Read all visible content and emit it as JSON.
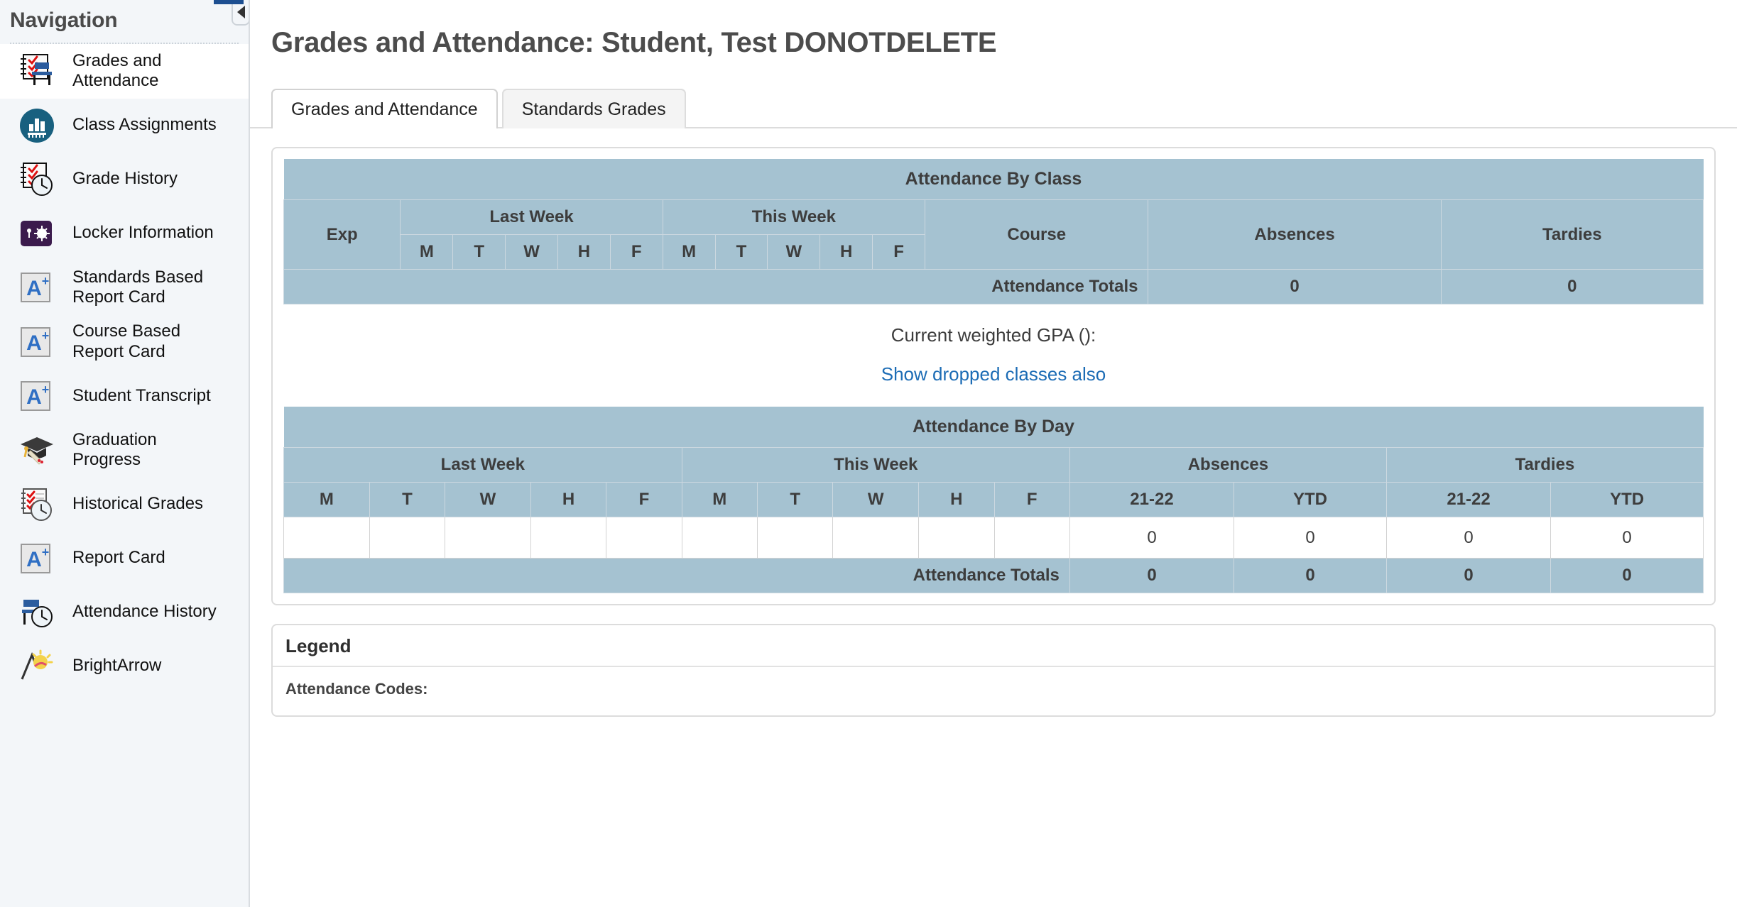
{
  "sidebar": {
    "title": "Navigation",
    "collapse_icon": "chevron-left-icon",
    "items": [
      {
        "label": "Grades and Attendance",
        "icon": "grades-attendance-icon",
        "active": true
      },
      {
        "label": "Class Assignments",
        "icon": "class-assignments-icon",
        "active": false
      },
      {
        "label": "Grade History",
        "icon": "grade-history-icon",
        "active": false
      },
      {
        "label": "Locker Information",
        "icon": "locker-information-icon",
        "active": false
      },
      {
        "label": "Standards Based Report Card",
        "icon": "report-card-a-plus-icon",
        "active": false
      },
      {
        "label": "Course Based Report Card",
        "icon": "report-card-a-plus-icon",
        "active": false
      },
      {
        "label": "Student Transcript",
        "icon": "report-card-a-plus-icon",
        "active": false
      },
      {
        "label": "Graduation Progress",
        "icon": "graduation-cap-icon",
        "active": false
      },
      {
        "label": "Historical Grades",
        "icon": "historical-grades-icon",
        "active": false
      },
      {
        "label": "Report Card",
        "icon": "report-card-a-plus-icon",
        "active": false
      },
      {
        "label": "Attendance History",
        "icon": "attendance-history-icon",
        "active": false
      },
      {
        "label": "BrightArrow",
        "icon": "brightarrow-icon",
        "active": false
      }
    ]
  },
  "header": {
    "page_title": "Grades and Attendance: Student, Test DONOTDELETE"
  },
  "tabs": [
    {
      "label": "Grades and Attendance",
      "active": true
    },
    {
      "label": "Standards Grades",
      "active": false
    }
  ],
  "attendance_by_class": {
    "title": "Attendance By Class",
    "exp_header": "Exp",
    "last_week_header": "Last Week",
    "this_week_header": "This Week",
    "days": [
      "M",
      "T",
      "W",
      "H",
      "F"
    ],
    "course_header": "Course",
    "absences_header": "Absences",
    "tardies_header": "Tardies",
    "totals_label": "Attendance Totals",
    "totals_absences": "0",
    "totals_tardies": "0"
  },
  "gpa": {
    "label": "Current weighted GPA ():",
    "show_dropped_link": "Show dropped classes also"
  },
  "attendance_by_day": {
    "title": "Attendance By Day",
    "last_week_header": "Last Week",
    "this_week_header": "This Week",
    "days": [
      "M",
      "T",
      "W",
      "H",
      "F"
    ],
    "absences_header": "Absences",
    "tardies_header": "Tardies",
    "year_header": "21-22",
    "ytd_header": "YTD",
    "row_values": {
      "absences_year": "0",
      "absences_ytd": "0",
      "tardies_year": "0",
      "tardies_ytd": "0"
    },
    "totals_label": "Attendance Totals",
    "totals": {
      "absences_year": "0",
      "absences_ytd": "0",
      "tardies_year": "0",
      "tardies_ytd": "0"
    }
  },
  "legend": {
    "title": "Legend",
    "attendance_codes_label": "Attendance Codes:"
  },
  "colors": {
    "table_header_bg": "#a5c2d1",
    "sidebar_bg": "#f3f6f9",
    "link": "#1c6cb5",
    "title_text": "#4c4c4c",
    "accent_blue": "#1d4f91"
  }
}
